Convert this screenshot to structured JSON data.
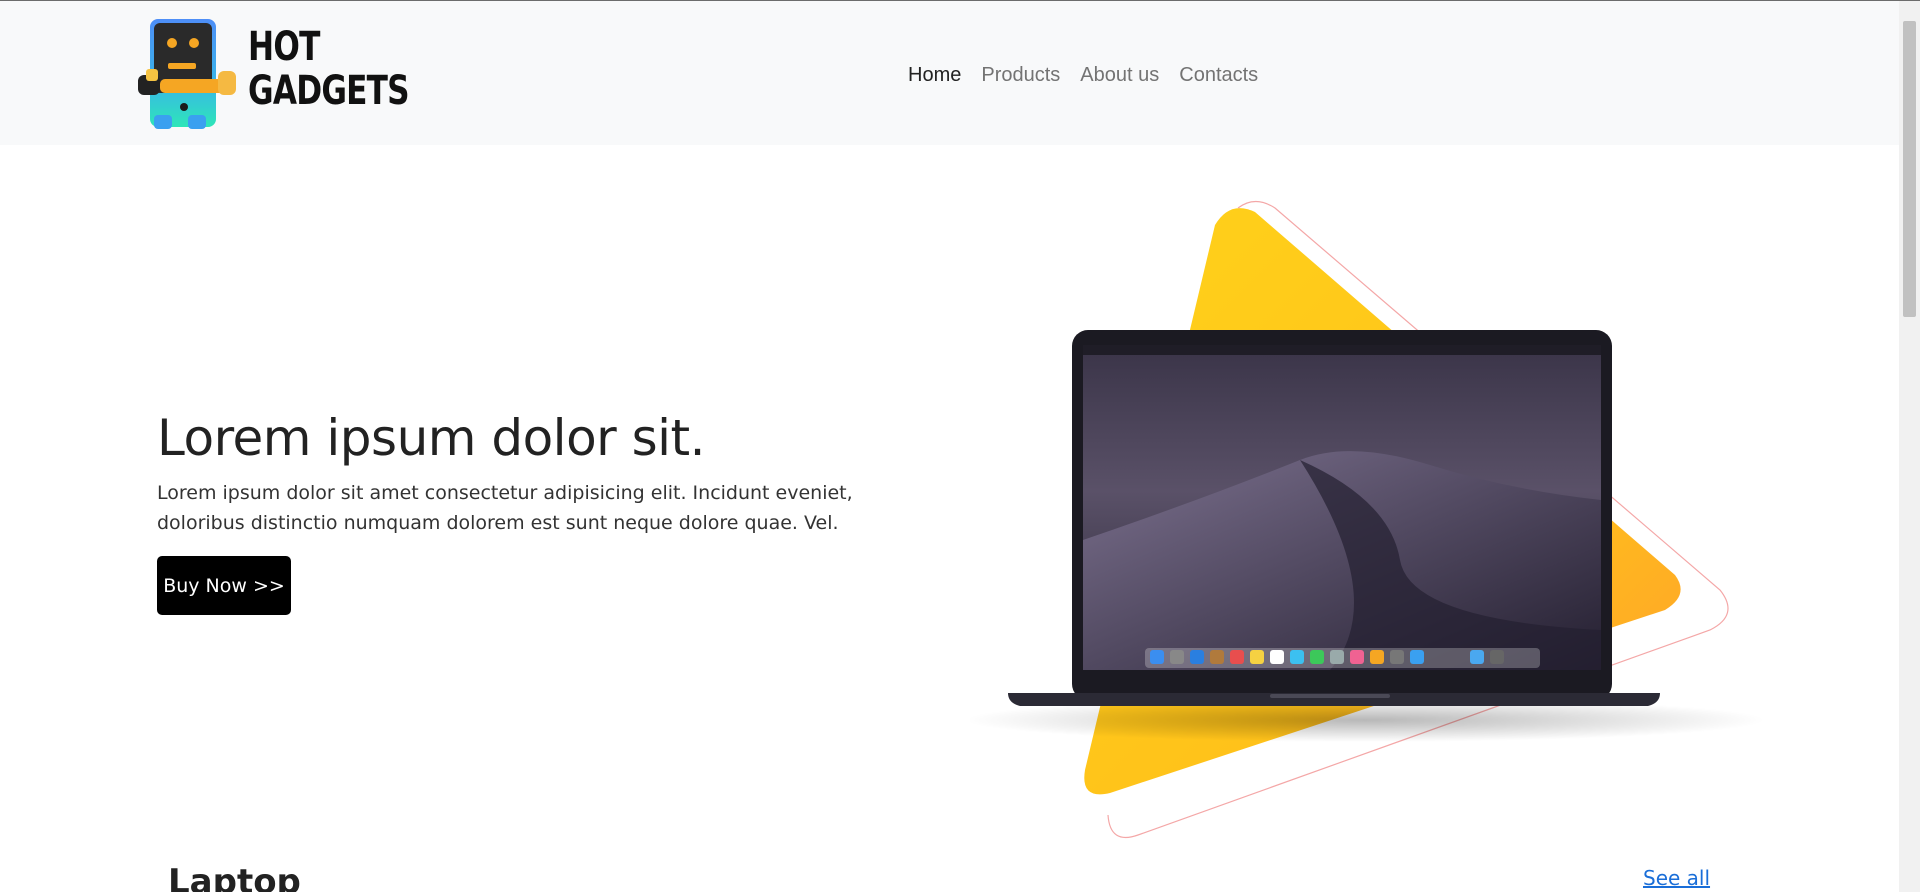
{
  "brand": {
    "line1": "HOT",
    "line2": "GADGETS"
  },
  "nav": {
    "items": [
      "Home",
      "Products",
      "About us",
      "Contacts"
    ],
    "active": "Home"
  },
  "hero": {
    "title": "Lorem ipsum dolor sit.",
    "text": "Lorem ipsum dolor sit amet consectetur adipisicing elit. Incidunt eveniet, doloribus distinctio numquam dolorem est sunt neque dolore quae. Vel.",
    "button": "Buy Now >>"
  },
  "section": {
    "title": "Laptop",
    "see_all": "See all"
  },
  "colors": {
    "button_bg": "#000000",
    "link": "#1a6ed8",
    "navbar_bg": "#f8f9fa",
    "triangle_accent": "#ffc21a"
  }
}
